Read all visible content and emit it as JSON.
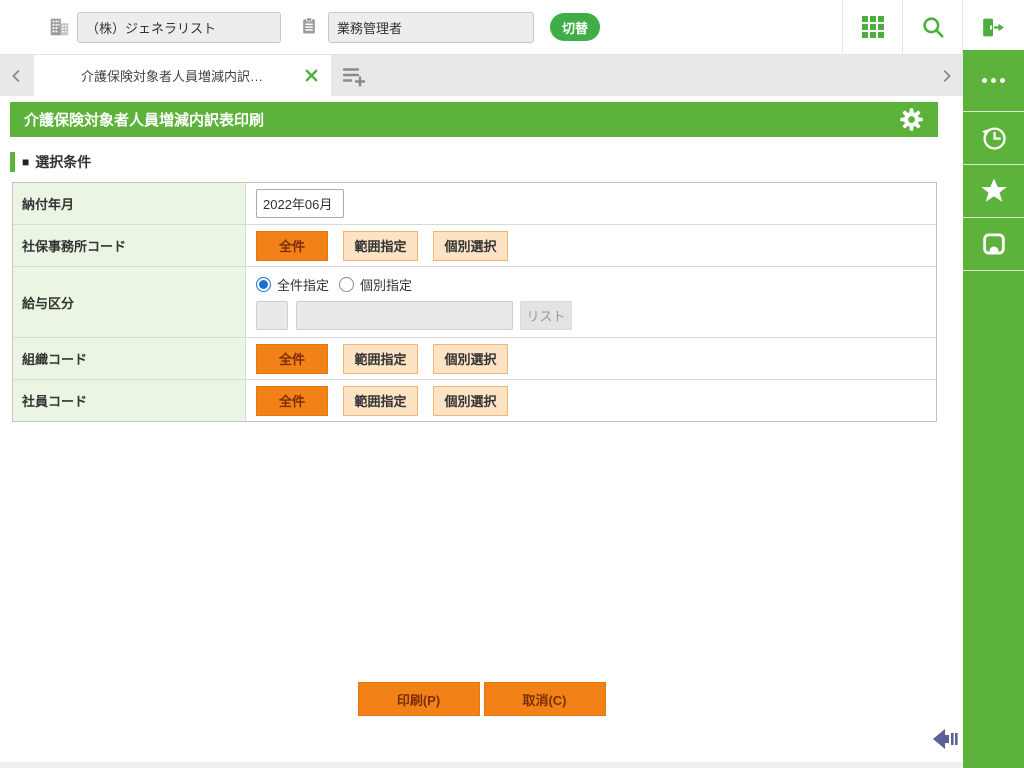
{
  "header": {
    "company": {
      "value": "（株）ジェネラリスト"
    },
    "role": {
      "value": "業務管理者"
    },
    "switch_button": "切替"
  },
  "tabs": {
    "active": {
      "title": "介護保険対象者人員増減内訳…"
    }
  },
  "page": {
    "title": "介護保険対象者人員増減内訳表印刷",
    "section": {
      "marker": "■",
      "title": "選択条件"
    }
  },
  "form": {
    "payment_month": {
      "label": "納付年月",
      "value": "2022年06月"
    },
    "office_code": {
      "label": "社保事務所コード",
      "all": "全件",
      "range": "範囲指定",
      "individual": "個別選択"
    },
    "salary_class": {
      "label": "給与区分",
      "radio_all": "全件指定",
      "radio_individual": "個別指定",
      "code_value": "",
      "name_value": "",
      "list_button": "リスト"
    },
    "org_code": {
      "label": "組織コード",
      "all": "全件",
      "range": "範囲指定",
      "individual": "個別選択"
    },
    "employee_code": {
      "label": "社員コード",
      "all": "全件",
      "range": "範囲指定",
      "individual": "個別選択"
    }
  },
  "actions": {
    "print": "印刷(P)",
    "cancel": "取消(C)"
  },
  "icons": {
    "company": "building-icon",
    "role": "clipboard-icon",
    "apps": "grid-icon",
    "search": "search-icon",
    "logout": "logout-icon",
    "back": "chevron-left-icon",
    "forward": "chevron-right-icon",
    "close_tab": "close-icon",
    "add_tab": "add-tab-icon",
    "menu": "ellipsis-icon",
    "history": "history-icon",
    "favorite": "star-icon",
    "memo": "tray-icon",
    "settings": "gear-icon",
    "collapse": "collapse-arrow-icon"
  },
  "colors": {
    "brand_green": "#5cb23a",
    "button_green": "#3fae49",
    "accent_orange": "#f28118",
    "accent_orange_text": "#7b2e05",
    "light_orange": "#fce3c4",
    "label_cell_green": "#eaf6e3",
    "radio_blue": "#1d6fd1",
    "collapse_blue": "#5c6095"
  }
}
